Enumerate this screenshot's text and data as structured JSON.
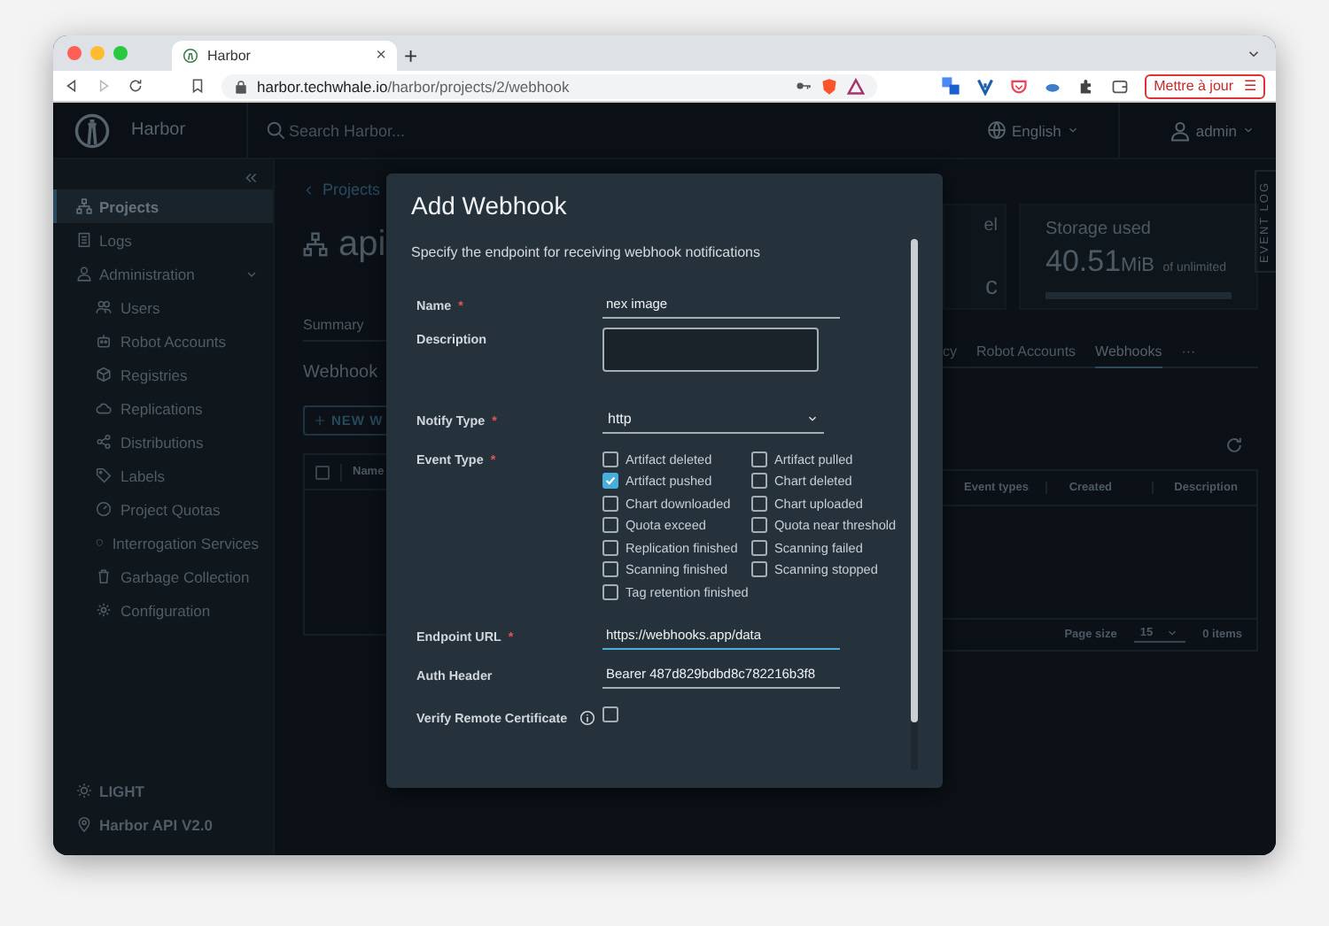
{
  "browser": {
    "tab_title": "Harbor",
    "tab_close": "×",
    "new_tab": "+",
    "url": {
      "host": "harbor.techwhale.io",
      "path": "/harbor/projects/2/webhook"
    },
    "update_button": "Mettre à jour",
    "update_menu": "☰"
  },
  "app_header": {
    "brand": "Harbor",
    "search": {
      "placeholder": "Search Harbor..."
    },
    "language": "English",
    "user": "admin"
  },
  "sidebar": {
    "items": [
      {
        "label": "Projects",
        "selected": true
      },
      {
        "label": "Logs",
        "selected": false
      },
      {
        "label": "Administration",
        "selected": false,
        "expanded": true,
        "children": [
          {
            "label": "Users",
            "selected": false
          },
          {
            "label": "Robot Accounts",
            "selected": false
          },
          {
            "label": "Registries",
            "selected": false
          },
          {
            "label": "Replications",
            "selected": false
          },
          {
            "label": "Distributions",
            "selected": false
          },
          {
            "label": "Labels",
            "selected": false
          },
          {
            "label": "Project Quotas",
            "selected": false
          },
          {
            "label": "Interrogation Services",
            "selected": false
          },
          {
            "label": "Garbage Collection",
            "selected": false
          },
          {
            "label": "Configuration",
            "selected": false
          }
        ]
      }
    ],
    "footer": [
      "LIGHT",
      "Harbor API V2.0"
    ]
  },
  "project": {
    "breadcrumb": "Projects",
    "name": "api",
    "cards": [
      {
        "title": "el",
        "value": "c"
      },
      {
        "title": "Storage used",
        "value": "40.51",
        "unit": "MiB",
        "suffix": "of unlimited",
        "level": 0
      }
    ],
    "event_log": "EVENT LOG",
    "tabs": [
      {
        "label": "Summary",
        "selected": false
      },
      {
        "label": "cy",
        "selected": false
      },
      {
        "label": "Robot Accounts",
        "selected": false
      },
      {
        "label": "Webhooks",
        "selected": true
      },
      {
        "label": "···",
        "selected": false
      }
    ],
    "section_title": "Webhook",
    "new_button": "NEW W",
    "table": {
      "select_all": {
        "checked": false
      },
      "columns": [
        "Name",
        "Event types",
        "Created",
        "Description"
      ],
      "page_size_label": "Page size",
      "page_size": "15",
      "count": "0 items"
    }
  },
  "dialog": {
    "title": "Add Webhook",
    "subtitle": "Specify the endpoint for receiving webhook notifications",
    "fields": [
      {
        "kind": "text",
        "label": "Name",
        "asterisk": "*",
        "value": "nex image",
        "focused": false
      },
      {
        "kind": "textarea",
        "label": "Description"
      },
      {
        "kind": "select",
        "label": "Notify Type",
        "asterisk": "*",
        "value": "http"
      },
      {
        "kind": "checkboxes",
        "label": "Event Type",
        "asterisk": "*",
        "options": [
          {
            "label": "Artifact deleted",
            "checked": false
          },
          {
            "label": "Artifact pulled",
            "checked": false
          },
          {
            "label": "Artifact pushed",
            "checked": true
          },
          {
            "label": "Chart deleted",
            "checked": false
          },
          {
            "label": "Chart downloaded",
            "checked": false
          },
          {
            "label": "Chart uploaded",
            "checked": false
          },
          {
            "label": "Quota exceed",
            "checked": false
          },
          {
            "label": "Quota near threshold",
            "checked": false
          },
          {
            "label": "Replication finished",
            "checked": false
          },
          {
            "label": "Scanning failed",
            "checked": false
          },
          {
            "label": "Scanning finished",
            "checked": false
          },
          {
            "label": "Scanning stopped",
            "checked": false
          },
          {
            "label": "Tag retention finished",
            "checked": false
          }
        ]
      },
      {
        "kind": "text",
        "label": "Endpoint URL",
        "asterisk": "*",
        "value": "https://webhooks.app/data",
        "focused": true
      },
      {
        "kind": "text",
        "label": "Auth Header",
        "value": "Bearer 487d829bdbd8c782216b3f8",
        "focused": false
      },
      {
        "kind": "checkbox",
        "label": "Verify Remote Certificate",
        "info": true,
        "checked": false
      }
    ]
  }
}
